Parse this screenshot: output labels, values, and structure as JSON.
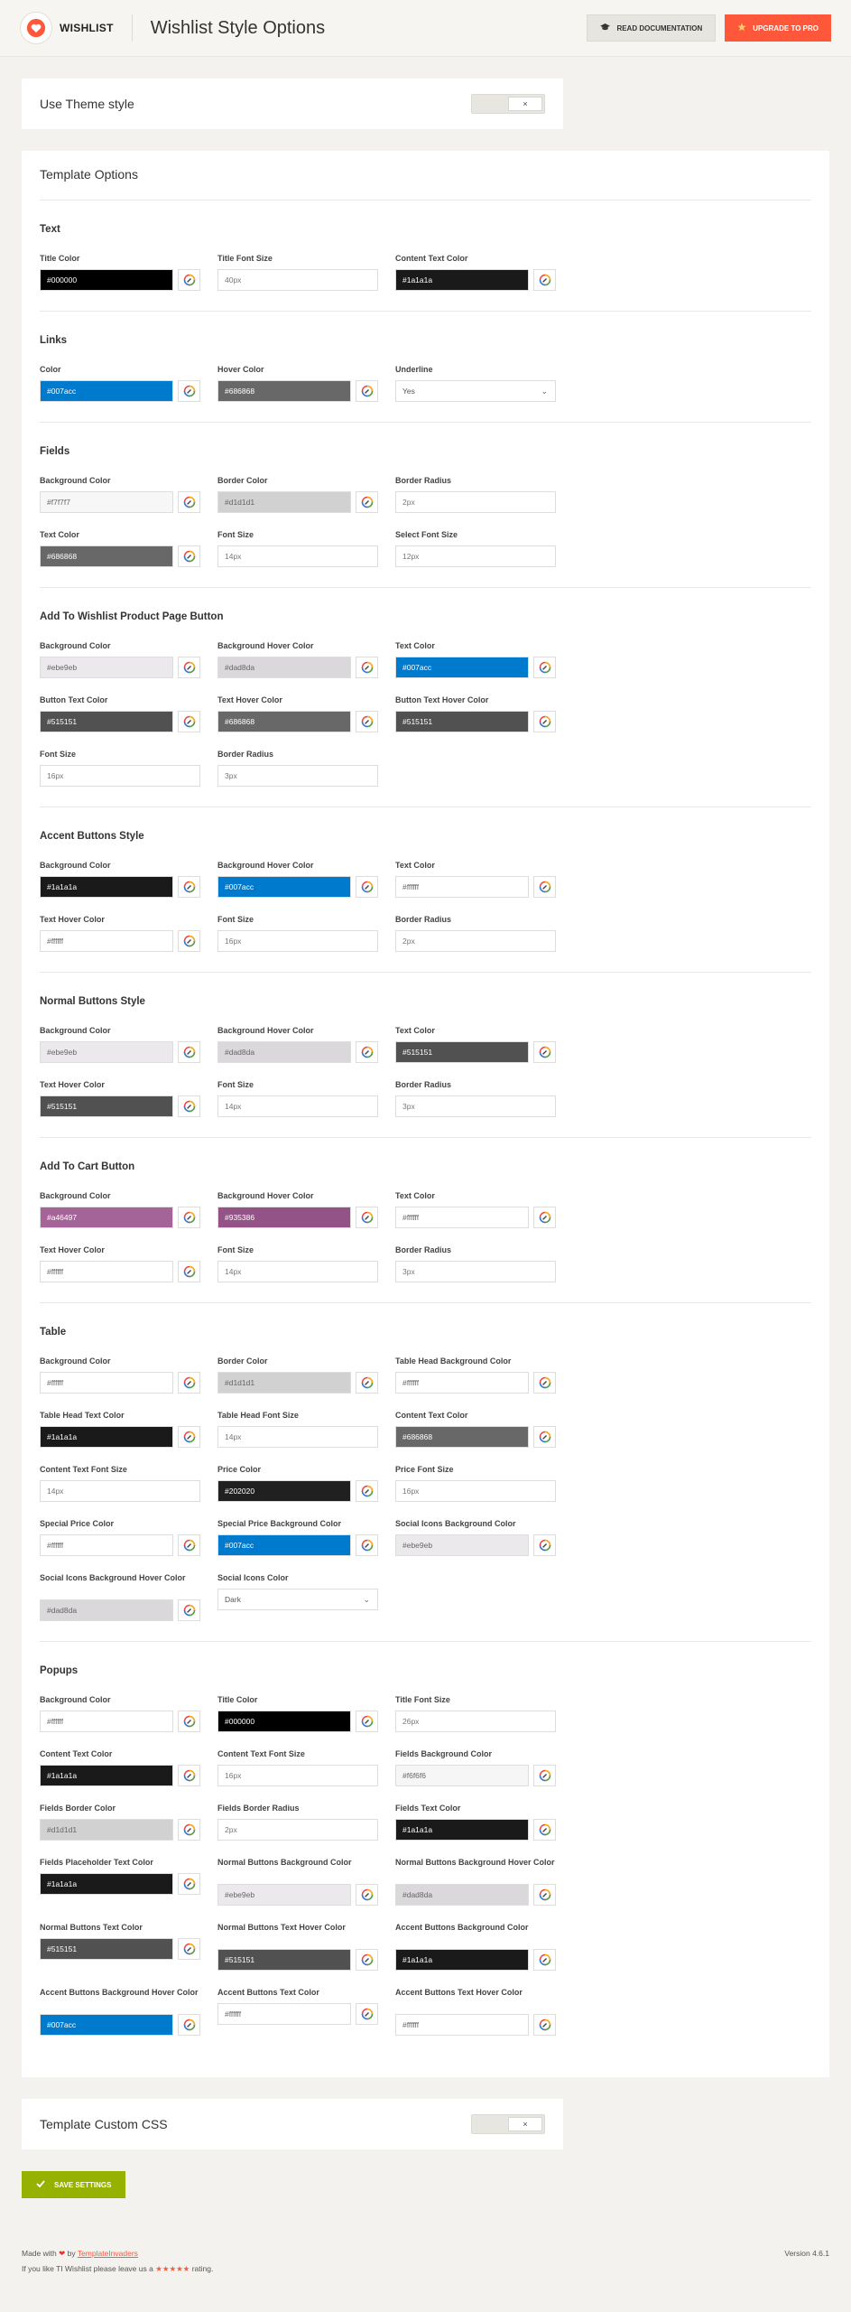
{
  "header": {
    "logo_text": "WISHLIST",
    "title": "Wishlist Style Options",
    "doc_button": "READ DOCUMENTATION",
    "pro_button": "UPGRADE TO PRO"
  },
  "theme_style": {
    "label": "Use Theme style",
    "toggle": "×"
  },
  "template": {
    "title": "Template Options",
    "sections": [
      {
        "title": "Text",
        "fields": [
          {
            "label": "Title Color",
            "type": "color",
            "value": "#000000",
            "color": "#000000",
            "dark": true
          },
          {
            "label": "Title Font Size",
            "type": "text",
            "value": "40px"
          },
          {
            "label": "Content Text Color",
            "type": "color",
            "value": "#1a1a1a",
            "color": "#1a1a1a",
            "dark": true
          }
        ]
      },
      {
        "title": "Links",
        "fields": [
          {
            "label": "Color",
            "type": "color",
            "value": "#007acc",
            "color": "#007acc",
            "dark": true
          },
          {
            "label": "Hover Color",
            "type": "color",
            "value": "#686868",
            "color": "#686868",
            "dark": true
          },
          {
            "label": "Underline",
            "type": "select",
            "value": "Yes"
          }
        ]
      },
      {
        "title": "Fields",
        "fields": [
          {
            "label": "Background Color",
            "type": "color",
            "value": "#f7f7f7",
            "color": "#f7f7f7",
            "dark": false
          },
          {
            "label": "Border Color",
            "type": "color",
            "value": "#d1d1d1",
            "color": "#d1d1d1",
            "dark": false
          },
          {
            "label": "Border Radius",
            "type": "text",
            "value": "2px"
          },
          {
            "label": "Text Color",
            "type": "color",
            "value": "#686868",
            "color": "#686868",
            "dark": true
          },
          {
            "label": "Font Size",
            "type": "text",
            "value": "14px"
          },
          {
            "label": "Select Font Size",
            "type": "text",
            "value": "12px"
          }
        ]
      },
      {
        "title": "Add To Wishlist Product Page Button",
        "fields": [
          {
            "label": "Background Color",
            "type": "color",
            "value": "#ebe9eb",
            "color": "#ebe9eb",
            "dark": false
          },
          {
            "label": "Background Hover Color",
            "type": "color",
            "value": "#dad8da",
            "color": "#dad8da",
            "dark": false
          },
          {
            "label": "Text Color",
            "type": "color",
            "value": "#007acc",
            "color": "#007acc",
            "dark": true
          },
          {
            "label": "Button Text Color",
            "type": "color",
            "value": "#515151",
            "color": "#515151",
            "dark": true
          },
          {
            "label": "Text Hover Color",
            "type": "color",
            "value": "#686868",
            "color": "#686868",
            "dark": true
          },
          {
            "label": "Button Text Hover Color",
            "type": "color",
            "value": "#515151",
            "color": "#515151",
            "dark": true
          },
          {
            "label": "Font Size",
            "type": "text",
            "value": "16px"
          },
          {
            "label": "Border Radius",
            "type": "text",
            "value": "3px"
          }
        ]
      },
      {
        "title": "Accent Buttons Style",
        "fields": [
          {
            "label": "Background Color",
            "type": "color",
            "value": "#1a1a1a",
            "color": "#1a1a1a",
            "dark": true
          },
          {
            "label": "Background Hover Color",
            "type": "color",
            "value": "#007acc",
            "color": "#007acc",
            "dark": true
          },
          {
            "label": "Text Color",
            "type": "color",
            "value": "#ffffff",
            "color": "#ffffff",
            "dark": false
          },
          {
            "label": "Text Hover Color",
            "type": "color",
            "value": "#ffffff",
            "color": "#ffffff",
            "dark": false
          },
          {
            "label": "Font Size",
            "type": "text",
            "value": "16px"
          },
          {
            "label": "Border Radius",
            "type": "text",
            "value": "2px"
          }
        ]
      },
      {
        "title": "Normal Buttons Style",
        "fields": [
          {
            "label": "Background Color",
            "type": "color",
            "value": "#ebe9eb",
            "color": "#ebe9eb",
            "dark": false
          },
          {
            "label": "Background Hover Color",
            "type": "color",
            "value": "#dad8da",
            "color": "#dad8da",
            "dark": false
          },
          {
            "label": "Text Color",
            "type": "color",
            "value": "#515151",
            "color": "#515151",
            "dark": true
          },
          {
            "label": "Text Hover Color",
            "type": "color",
            "value": "#515151",
            "color": "#515151",
            "dark": true
          },
          {
            "label": "Font Size",
            "type": "text",
            "value": "14px"
          },
          {
            "label": "Border Radius",
            "type": "text",
            "value": "3px"
          }
        ]
      },
      {
        "title": "Add To Cart Button",
        "fields": [
          {
            "label": "Background Color",
            "type": "color",
            "value": "#a46497",
            "color": "#a46497",
            "dark": true
          },
          {
            "label": "Background Hover Color",
            "type": "color",
            "value": "#935386",
            "color": "#935386",
            "dark": true
          },
          {
            "label": "Text Color",
            "type": "color",
            "value": "#ffffff",
            "color": "#ffffff",
            "dark": false
          },
          {
            "label": "Text Hover Color",
            "type": "color",
            "value": "#ffffff",
            "color": "#ffffff",
            "dark": false
          },
          {
            "label": "Font Size",
            "type": "text",
            "value": "14px"
          },
          {
            "label": "Border Radius",
            "type": "text",
            "value": "3px"
          }
        ]
      },
      {
        "title": "Table",
        "fields": [
          {
            "label": "Background Color",
            "type": "color",
            "value": "#ffffff",
            "color": "#ffffff",
            "dark": false
          },
          {
            "label": "Border Color",
            "type": "color",
            "value": "#d1d1d1",
            "color": "#d1d1d1",
            "dark": false
          },
          {
            "label": "Table Head Background Color",
            "type": "color",
            "value": "#ffffff",
            "color": "#ffffff",
            "dark": false
          },
          {
            "label": "Table Head Text Color",
            "type": "color",
            "value": "#1a1a1a",
            "color": "#1a1a1a",
            "dark": true
          },
          {
            "label": "Table Head Font Size",
            "type": "text",
            "value": "14px"
          },
          {
            "label": "Content Text Color",
            "type": "color",
            "value": "#686868",
            "color": "#686868",
            "dark": true
          },
          {
            "label": "Content Text Font Size",
            "type": "text",
            "value": "14px"
          },
          {
            "label": "Price Color",
            "type": "color",
            "value": "#202020",
            "color": "#202020",
            "dark": true
          },
          {
            "label": "Price Font Size",
            "type": "text",
            "value": "16px"
          },
          {
            "label": "Special Price Color",
            "type": "color",
            "value": "#ffffff",
            "color": "#ffffff",
            "dark": false
          },
          {
            "label": "Special Price Background Color",
            "type": "color",
            "value": "#007acc",
            "color": "#007acc",
            "dark": true
          },
          {
            "label": "Social Icons Background Color",
            "type": "color",
            "value": "#ebe9eb",
            "color": "#ebe9eb",
            "dark": false
          },
          {
            "label": "Social Icons Background Hover Color",
            "type": "color",
            "value": "#dad8da",
            "color": "#dad8da",
            "dark": false
          },
          {
            "label": "Social Icons Color",
            "type": "select",
            "value": "Dark"
          }
        ]
      },
      {
        "title": "Popups",
        "fields": [
          {
            "label": "Background Color",
            "type": "color",
            "value": "#ffffff",
            "color": "#ffffff",
            "dark": false
          },
          {
            "label": "Title Color",
            "type": "color",
            "value": "#000000",
            "color": "#000000",
            "dark": true
          },
          {
            "label": "Title Font Size",
            "type": "text",
            "value": "26px"
          },
          {
            "label": "Content Text Color",
            "type": "color",
            "value": "#1a1a1a",
            "color": "#1a1a1a",
            "dark": true
          },
          {
            "label": "Content Text Font Size",
            "type": "text",
            "value": "16px"
          },
          {
            "label": "Fields Background Color",
            "type": "color",
            "value": "#f6f6f6",
            "color": "#f6f6f6",
            "dark": false
          },
          {
            "label": "Fields Border Color",
            "type": "color",
            "value": "#d1d1d1",
            "color": "#d1d1d1",
            "dark": false
          },
          {
            "label": "Fields Border Radius",
            "type": "text",
            "value": "2px"
          },
          {
            "label": "Fields Text Color",
            "type": "color",
            "value": "#1a1a1a",
            "color": "#1a1a1a",
            "dark": true
          },
          {
            "label": "Fields Placeholder Text Color",
            "type": "color",
            "value": "#1a1a1a",
            "color": "#1a1a1a",
            "dark": true
          },
          {
            "label": "Normal Buttons Background Color",
            "type": "color",
            "value": "#ebe9eb",
            "color": "#ebe9eb",
            "dark": false
          },
          {
            "label": "Normal Buttons Background Hover Color",
            "type": "color",
            "value": "#dad8da",
            "color": "#dad8da",
            "dark": false
          },
          {
            "label": "Normal Buttons Text Color",
            "type": "color",
            "value": "#515151",
            "color": "#515151",
            "dark": true
          },
          {
            "label": "Normal Buttons Text Hover Color",
            "type": "color",
            "value": "#515151",
            "color": "#515151",
            "dark": true
          },
          {
            "label": "Accent Buttons Background Color",
            "type": "color",
            "value": "#1a1a1a",
            "color": "#1a1a1a",
            "dark": true
          },
          {
            "label": "Accent Buttons Background Hover Color",
            "type": "color",
            "value": "#007acc",
            "color": "#007acc",
            "dark": true
          },
          {
            "label": "Accent Buttons Text Color",
            "type": "color",
            "value": "#ffffff",
            "color": "#ffffff",
            "dark": false
          },
          {
            "label": "Accent Buttons Text Hover Color",
            "type": "color",
            "value": "#ffffff",
            "color": "#ffffff",
            "dark": false
          }
        ]
      }
    ]
  },
  "custom_css": {
    "label": "Template Custom CSS",
    "toggle": "×"
  },
  "save_button": "SAVE SETTINGS",
  "footer": {
    "made_with": "Made with",
    "by": "by",
    "author": "TemplateInvaders",
    "rating_prefix": "If you like TI Wishlist please leave us a",
    "stars": "★★★★★",
    "rating_suffix": "rating.",
    "version": "Version 4.6.1"
  },
  "icons": {
    "logo": "heart-logo-icon",
    "doc": "graduation-cap-icon",
    "pro": "star-icon",
    "picker": "color-wheel-icon",
    "save": "checkmark-icon",
    "footer_heart": "heart-icon"
  }
}
